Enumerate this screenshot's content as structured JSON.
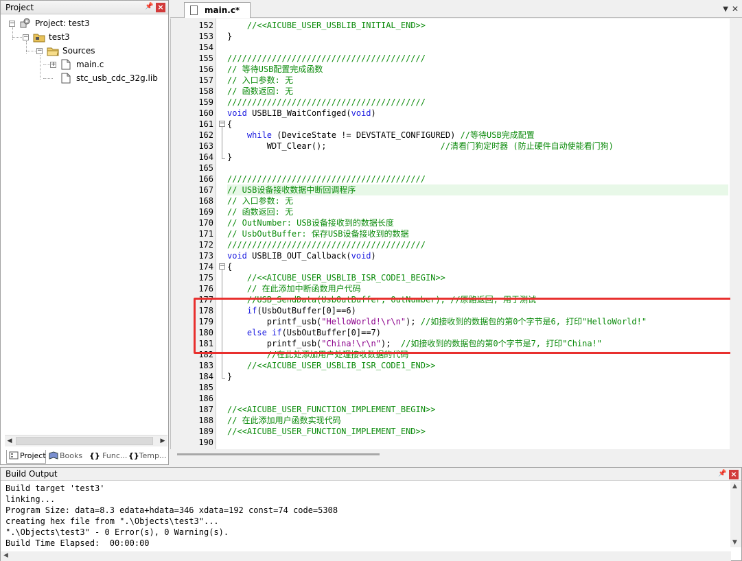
{
  "project_pane": {
    "title": "Project",
    "tree": {
      "root": "Project: test3",
      "target": "test3",
      "group": "Sources",
      "files": [
        "main.c",
        "stc_usb_cdc_32g.lib"
      ]
    },
    "tabs": [
      "Project",
      "Books",
      "Func...",
      "Temp..."
    ]
  },
  "editor": {
    "active_tab": "main.c*",
    "lines": [
      {
        "n": "152",
        "t": "    //<<AICUBE_USER_USBLIB_INITIAL_END>>"
      },
      {
        "n": "153",
        "t": "}"
      },
      {
        "n": "154",
        "t": ""
      },
      {
        "n": "155",
        "t": "////////////////////////////////////////"
      },
      {
        "n": "156",
        "t": "// 等待USB配置完成函数"
      },
      {
        "n": "157",
        "t": "// 入口参数: 无"
      },
      {
        "n": "158",
        "t": "// 函数返回: 无"
      },
      {
        "n": "159",
        "t": "////////////////////////////////////////"
      },
      {
        "n": "160",
        "t": "void USBLIB_WaitConfiged(void)"
      },
      {
        "n": "161",
        "t": "{"
      },
      {
        "n": "162",
        "t": "    while (DeviceState != DEVSTATE_CONFIGURED) //等待USB完成配置"
      },
      {
        "n": "163",
        "t": "        WDT_Clear();                       //清看门狗定时器 (防止硬件自动使能看门狗)"
      },
      {
        "n": "164",
        "t": "}"
      },
      {
        "n": "165",
        "t": ""
      },
      {
        "n": "166",
        "t": "////////////////////////////////////////"
      },
      {
        "n": "167",
        "t": "// USB设备接收数据中断回调程序"
      },
      {
        "n": "168",
        "t": "// 入口参数: 无"
      },
      {
        "n": "169",
        "t": "// 函数返回: 无"
      },
      {
        "n": "170",
        "t": "// OutNumber: USB设备接收到的数据长度"
      },
      {
        "n": "171",
        "t": "// UsbOutBuffer: 保存USB设备接收到的数据"
      },
      {
        "n": "172",
        "t": "////////////////////////////////////////"
      },
      {
        "n": "173",
        "t": "void USBLIB_OUT_Callback(void)"
      },
      {
        "n": "174",
        "t": "{"
      },
      {
        "n": "175",
        "t": "    //<<AICUBE_USER_USBLIB_ISR_CODE1_BEGIN>>"
      },
      {
        "n": "176",
        "t": "    // 在此添加中断函数用户代码"
      },
      {
        "n": "177",
        "t": "    //USB_SendData(UsbOutBuffer, OutNumber); //原路返回, 用于测试"
      },
      {
        "n": "178",
        "t": "    if(UsbOutBuffer[0]==6)"
      },
      {
        "n": "179",
        "t": "        printf_usb(\"HelloWorld!\\r\\n\"); //如接收到的数据包的第0个字节是6, 打印\"HelloWorld!\""
      },
      {
        "n": "180",
        "t": "    else if(UsbOutBuffer[0]==7)"
      },
      {
        "n": "181",
        "t": "        printf_usb(\"China!\\r\\n\");  //如接收到的数据包的第0个字节是7, 打印\"China!\""
      },
      {
        "n": "182",
        "t": "        //在此处添加用户处理接收数据的代码"
      },
      {
        "n": "183",
        "t": "    //<<AICUBE_USER_USBLIB_ISR_CODE1_END>>"
      },
      {
        "n": "184",
        "t": "}"
      },
      {
        "n": "185",
        "t": ""
      },
      {
        "n": "186",
        "t": ""
      },
      {
        "n": "187",
        "t": "//<<AICUBE_USER_FUNCTION_IMPLEMENT_BEGIN>>"
      },
      {
        "n": "188",
        "t": "// 在此添加用户函数实现代码"
      },
      {
        "n": "189",
        "t": "//<<AICUBE_USER_FUNCTION_IMPLEMENT_END>>"
      },
      {
        "n": "190",
        "t": ""
      }
    ]
  },
  "build_output": {
    "title": "Build Output",
    "lines": [
      "Build target 'test3'",
      "linking...",
      "Program Size: data=8.3 edata+hdata=346 xdata=192 const=74 code=5308",
      "creating hex file from \".\\Objects\\test3\"...",
      "\".\\Objects\\test3\" - 0 Error(s), 0 Warning(s).",
      "Build Time Elapsed:  00:00:00"
    ]
  },
  "colors": {
    "comment": "#0a8a0a",
    "keyword": "#1a1ae0",
    "string": "#8b008b",
    "highlight_box": "#e8302e",
    "current_line": "#e8f8e8"
  }
}
